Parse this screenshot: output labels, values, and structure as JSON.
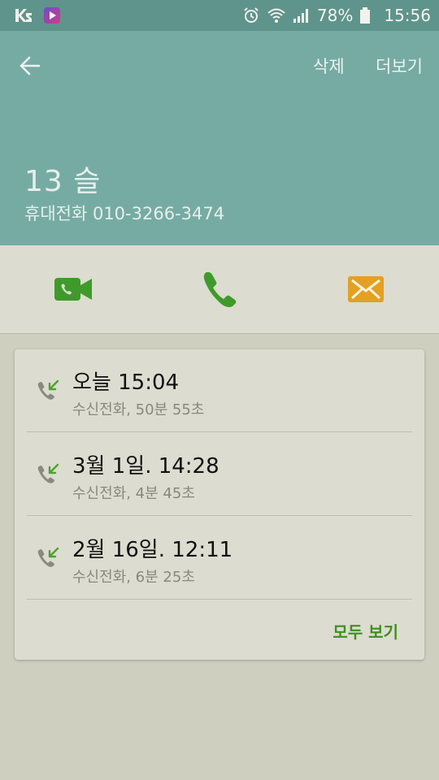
{
  "status_bar": {
    "battery": "78%",
    "time": "15:56"
  },
  "header": {
    "delete_label": "삭제",
    "more_label": "더보기",
    "contact_name": "13 슬",
    "contact_phone": "휴대전화 010-3266-3474"
  },
  "actions": {
    "icons": [
      "video-call-icon",
      "phone-icon",
      "mail-icon"
    ]
  },
  "history": {
    "items": [
      {
        "date": "오늘 15:04",
        "detail": "수신전화, 50분 55초"
      },
      {
        "date": "3월 1일. 14:28",
        "detail": "수신전화, 4분 45초"
      },
      {
        "date": "2월 16일. 12:11",
        "detail": "수신전화, 6분 25초"
      }
    ],
    "view_all_label": "모두 보기"
  },
  "colors": {
    "header_bg": "#76aba3",
    "status_bg": "#5f948c",
    "call_green": "#3e9b2a",
    "message_orange": "#e3a022"
  }
}
